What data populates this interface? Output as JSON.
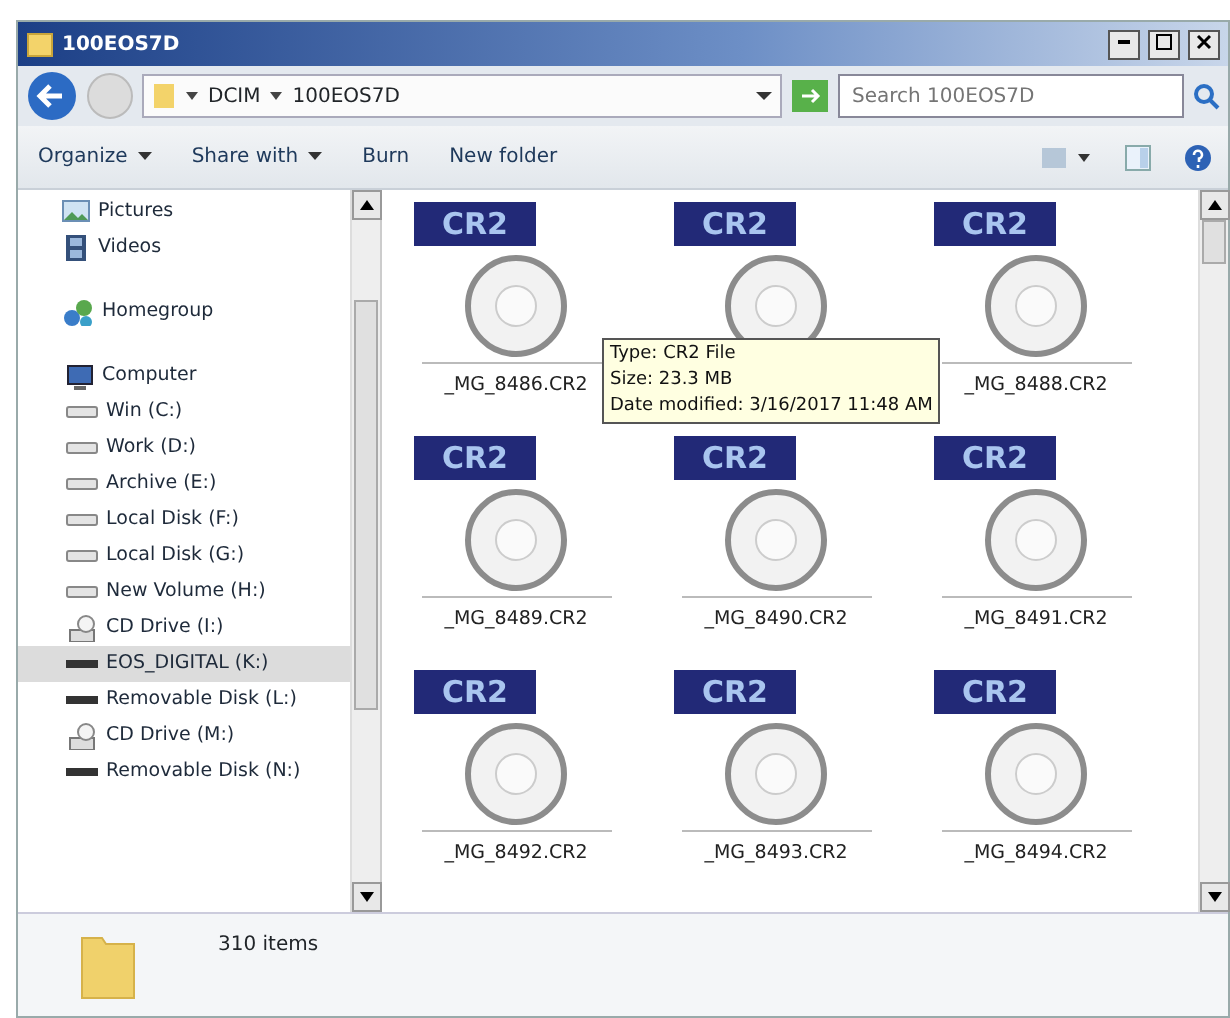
{
  "window": {
    "title": "100EOS7D"
  },
  "address": {
    "crumbs": [
      "DCIM",
      "100EOS7D"
    ],
    "search_placeholder": "Search 100EOS7D"
  },
  "toolbar": [
    {
      "label": "Organize",
      "dropdown": true
    },
    {
      "label": "Share with",
      "dropdown": true
    },
    {
      "label": "Burn",
      "dropdown": false
    },
    {
      "label": "New folder",
      "dropdown": false
    }
  ],
  "sidebar": {
    "items": [
      {
        "label": "Pictures",
        "kind": "pictures",
        "selected": false
      },
      {
        "label": "Videos",
        "kind": "videos",
        "selected": false
      },
      {
        "label": "Homegroup",
        "kind": "homegroup",
        "selected": false
      },
      {
        "label": "Computer",
        "kind": "computer",
        "selected": false,
        "children": [
          {
            "label": "Win (C:)",
            "kind": "drive",
            "selected": false
          },
          {
            "label": "Work (D:)",
            "kind": "drive",
            "selected": false
          },
          {
            "label": "Archive (E:)",
            "kind": "drive",
            "selected": false
          },
          {
            "label": "Local Disk (F:)",
            "kind": "drive",
            "selected": false
          },
          {
            "label": "Local Disk (G:)",
            "kind": "drive",
            "selected": false
          },
          {
            "label": "New Volume (H:)",
            "kind": "drive",
            "selected": false
          },
          {
            "label": "CD Drive (I:)",
            "kind": "cd",
            "selected": false
          },
          {
            "label": "EOS_DIGITAL (K:)",
            "kind": "removable",
            "selected": true
          },
          {
            "label": "Removable Disk (L:)",
            "kind": "removable",
            "selected": false
          },
          {
            "label": "CD Drive (M:)",
            "kind": "cd",
            "selected": false
          },
          {
            "label": "Removable Disk (N:)",
            "kind": "removable",
            "selected": false
          }
        ]
      }
    ]
  },
  "files": [
    {
      "badge": "CR2",
      "name": "_MG_8486.CR2"
    },
    {
      "badge": "CR2"
    },
    {
      "badge": "CR2",
      "name": "_MG_8488.CR2"
    },
    {
      "badge": "CR2",
      "name": "_MG_8489.CR2"
    },
    {
      "badge": "CR2",
      "name": "_MG_8490.CR2"
    },
    {
      "badge": "CR2",
      "name": "_MG_8491.CR2"
    },
    {
      "badge": "CR2",
      "name": "_MG_8492.CR2"
    },
    {
      "badge": "CR2",
      "name": "_MG_8493.CR2"
    },
    {
      "badge": "CR2",
      "name": "_MG_8494.CR2"
    }
  ],
  "tooltip": {
    "lines": [
      "Type: CR2 File",
      "Size: 23.3 MB",
      "Date modified: 3/16/2017 11:48 AM"
    ]
  },
  "status_bar": {
    "count": "310 items"
  }
}
